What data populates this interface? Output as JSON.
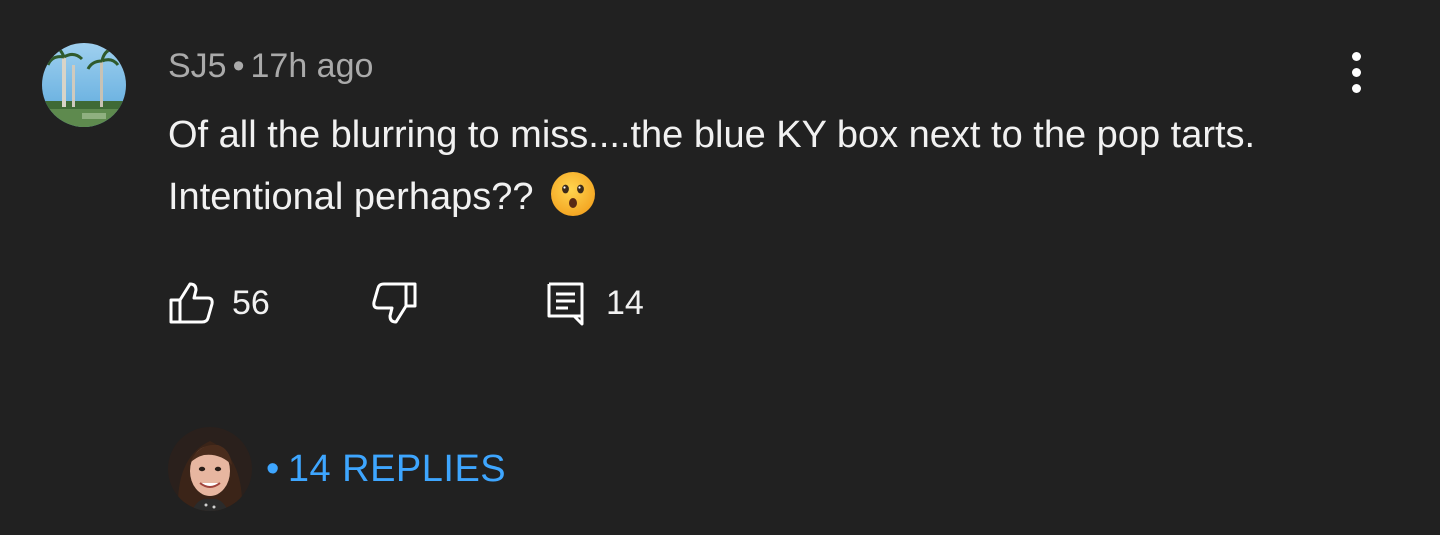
{
  "comment": {
    "author": "SJ5",
    "separator": "•",
    "time": "17h ago",
    "text": "Of all the blurring to miss....the blue KY box next to the pop tarts. Intentional perhaps??",
    "emoji": "hushed-face",
    "likes": "56",
    "reply_count": "14"
  },
  "replies": {
    "separator": "•",
    "label": "14 REPLIES"
  },
  "colors": {
    "background": "#212121",
    "link": "#3ea6ff",
    "meta": "#aaaaaa"
  },
  "icons": {
    "like": "thumbs-up-icon",
    "dislike": "thumbs-down-icon",
    "reply": "comment-icon",
    "more": "more-vertical-icon"
  }
}
